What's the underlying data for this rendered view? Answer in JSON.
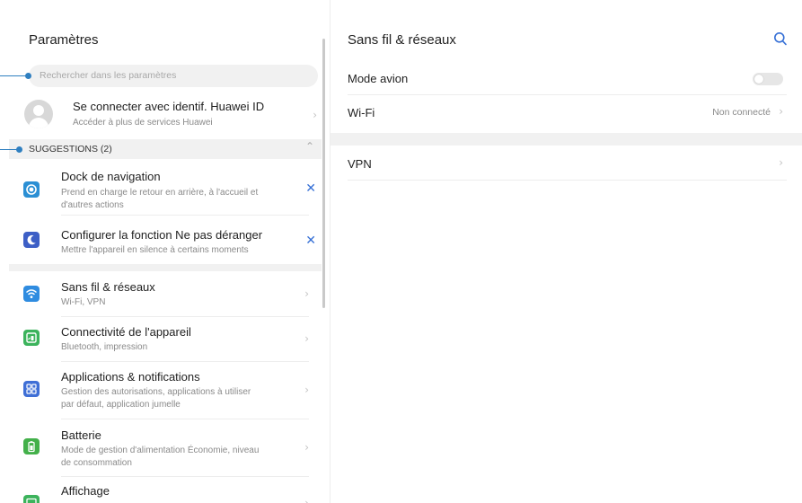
{
  "left": {
    "title": "Paramètres",
    "search_placeholder": "Rechercher dans les paramètres",
    "huawei_id": {
      "title": "Se connecter avec identif. Huawei ID",
      "subtitle": "Accéder à plus de services Huawei"
    },
    "suggestions_header": "SUGGESTIONS (2)",
    "suggestions": [
      {
        "title": "Dock de navigation",
        "subtitle_line1": "Prend en charge le retour en arrière, à l'accueil et",
        "subtitle_line2": "d'autres actions",
        "icon": "dock-icon",
        "color": "#2b8fd4"
      },
      {
        "title": "Configurer la fonction Ne pas déranger",
        "subtitle_line1": "Mettre l'appareil en silence à certains moments",
        "icon": "moon-icon",
        "color": "#3d5fc6"
      }
    ],
    "items": [
      {
        "title": "Sans fil & réseaux",
        "subtitle_line1": "Wi-Fi, VPN",
        "icon": "wifi-icon",
        "color": "#2f8ce0"
      },
      {
        "title": "Connectivité de l'appareil",
        "subtitle_line1": "Bluetooth, impression",
        "icon": "connectivity-icon",
        "color": "#3cb35c"
      },
      {
        "title": "Applications & notifications",
        "subtitle_line1": "Gestion des autorisations, applications à utiliser",
        "subtitle_line2": "par défaut, application jumelle",
        "icon": "apps-icon",
        "color": "#3f6fd6"
      },
      {
        "title": "Batterie",
        "subtitle_line1": "Mode de gestion d'alimentation Économie, niveau",
        "subtitle_line2": "de consommation",
        "icon": "battery-icon",
        "color": "#43b04a"
      },
      {
        "title": "Affichage",
        "icon": "display-icon",
        "color": "#3cb35c"
      }
    ]
  },
  "right": {
    "title": "Sans fil & réseaux",
    "rows": [
      {
        "label": "Mode avion"
      },
      {
        "label": "Wi-Fi",
        "status": "Non connecté"
      },
      {
        "label": "VPN"
      }
    ]
  }
}
